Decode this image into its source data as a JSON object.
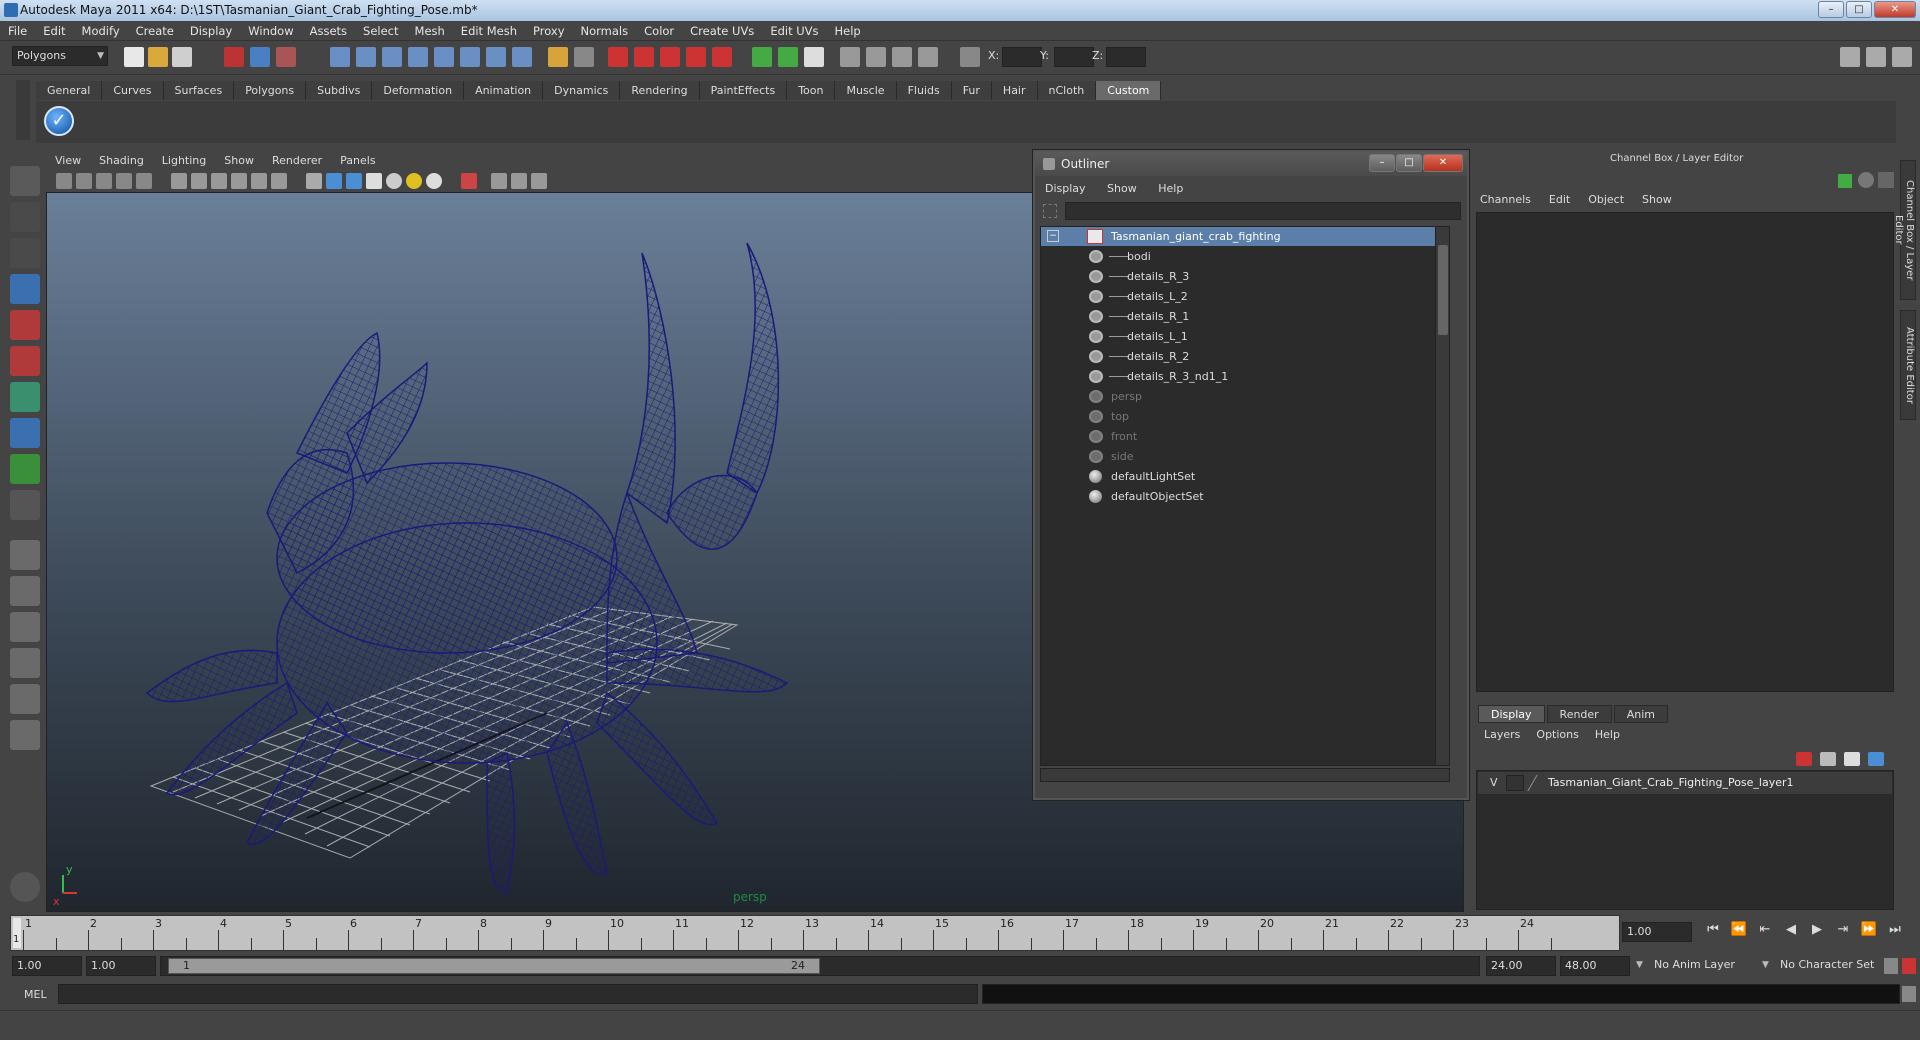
{
  "window": {
    "title": "Autodesk Maya 2011 x64: D:\\1ST\\Tasmanian_Giant_Crab_Fighting_Pose.mb*",
    "minimize": "–",
    "maximize": "□",
    "close": "✕"
  },
  "menubar": [
    "File",
    "Edit",
    "Modify",
    "Create",
    "Display",
    "Window",
    "Assets",
    "Select",
    "Mesh",
    "Edit Mesh",
    "Proxy",
    "Normals",
    "Color",
    "Create UVs",
    "Edit UVs",
    "Help"
  ],
  "statusline": {
    "menuset": "Polygons",
    "x_label": "X:",
    "y_label": "Y:",
    "z_label": "Z:"
  },
  "shelf": {
    "tabs": [
      "General",
      "Curves",
      "Surfaces",
      "Polygons",
      "Subdivs",
      "Deformation",
      "Animation",
      "Dynamics",
      "Rendering",
      "PaintEffects",
      "Toon",
      "Muscle",
      "Fluids",
      "Fur",
      "Hair",
      "nCloth",
      "Custom"
    ],
    "active_tab": "Custom"
  },
  "viewport": {
    "menu": [
      "View",
      "Shading",
      "Lighting",
      "Show",
      "Renderer",
      "Panels"
    ],
    "camera_label": "persp",
    "axis_y": "y",
    "axis_x": "x"
  },
  "outliner": {
    "title": "Outliner",
    "menu": [
      "Display",
      "Show",
      "Help"
    ],
    "collapse": "−",
    "items": [
      {
        "label": "Tasmanian_giant_crab_fighting",
        "selected": true,
        "indent": 0,
        "icon": "transform"
      },
      {
        "label": "bodi",
        "indent": 1,
        "icon": "mesh"
      },
      {
        "label": "details_R_3",
        "indent": 1,
        "icon": "mesh"
      },
      {
        "label": "details_L_2",
        "indent": 1,
        "icon": "mesh"
      },
      {
        "label": "details_R_1",
        "indent": 1,
        "icon": "mesh"
      },
      {
        "label": "details_L_1",
        "indent": 1,
        "icon": "mesh"
      },
      {
        "label": "details_R_2",
        "indent": 1,
        "icon": "mesh"
      },
      {
        "label": "details_R_3_nd1_1",
        "indent": 1,
        "icon": "mesh"
      },
      {
        "label": "persp",
        "dim": true,
        "indent": 0,
        "icon": "camera"
      },
      {
        "label": "top",
        "dim": true,
        "indent": 0,
        "icon": "camera"
      },
      {
        "label": "front",
        "dim": true,
        "indent": 0,
        "icon": "camera"
      },
      {
        "label": "side",
        "dim": true,
        "indent": 0,
        "icon": "camera"
      },
      {
        "label": "defaultLightSet",
        "indent": 0,
        "icon": "set"
      },
      {
        "label": "defaultObjectSet",
        "indent": 0,
        "icon": "set"
      }
    ]
  },
  "channelbox": {
    "title": "Channel Box / Layer Editor",
    "menu": [
      "Channels",
      "Edit",
      "Object",
      "Show"
    ],
    "side_tabs": [
      "Channel Box / Layer Editor",
      "Attribute Editor"
    ]
  },
  "layer_editor": {
    "tabs": [
      "Display",
      "Render",
      "Anim"
    ],
    "active_tab": "Display",
    "menu": [
      "Layers",
      "Options",
      "Help"
    ],
    "layer": {
      "visible": "V",
      "name": "Tasmanian_Giant_Crab_Fighting_Pose_layer1"
    }
  },
  "timeline": {
    "frames": [
      "1",
      "2",
      "3",
      "4",
      "5",
      "6",
      "7",
      "8",
      "9",
      "10",
      "11",
      "12",
      "13",
      "14",
      "15",
      "16",
      "17",
      "18",
      "19",
      "20",
      "21",
      "22",
      "23",
      "24"
    ],
    "current_frame_marker": "1",
    "current_frame": "1.00",
    "playback_buttons": [
      "⏮",
      "⏪",
      "⇤",
      "◀",
      "▶",
      "⇥",
      "⏩",
      "⏭"
    ]
  },
  "range": {
    "start_time": "1.00",
    "playback_start": "1.00",
    "slider_start": "1",
    "slider_end": "24",
    "playback_end": "24.00",
    "end_time": "48.00",
    "anim_layer": "No Anim Layer",
    "character_set": "No Character Set"
  },
  "command_line": {
    "label": "MEL"
  },
  "colors": {
    "wireframe": "#1a1a7a",
    "selection": "#5b7fa8",
    "grid": "#b8b8b8",
    "persp_label": "#1f8a43"
  }
}
